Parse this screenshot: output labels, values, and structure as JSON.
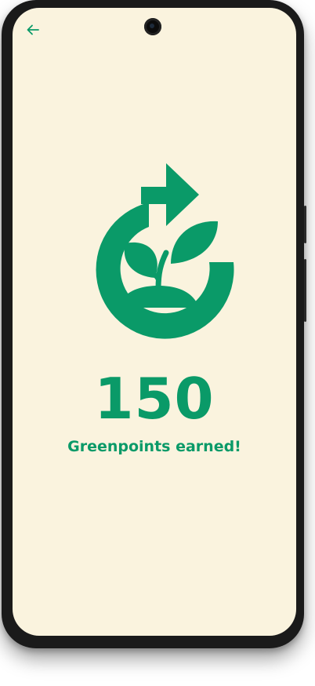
{
  "colors": {
    "accent": "#0a9a68",
    "background": "#faf3de",
    "frame": "#1a1a1a"
  },
  "header": {
    "back_icon": "arrow-left-icon"
  },
  "hero": {
    "icon": "recycle-plant-icon"
  },
  "reward": {
    "points": "150",
    "label": "Greenpoints earned!"
  }
}
